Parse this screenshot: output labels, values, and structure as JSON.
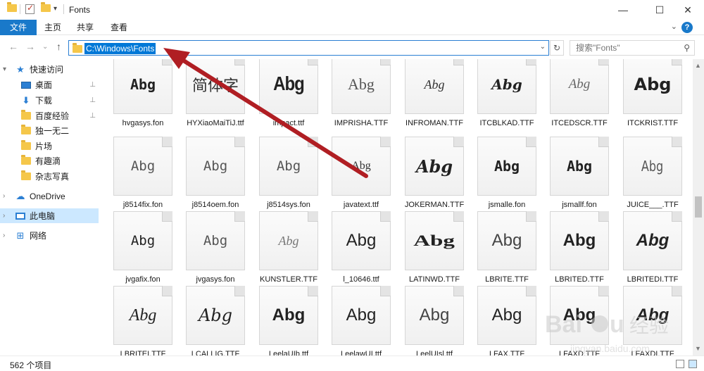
{
  "window": {
    "title": "Fonts",
    "minimize": "—",
    "maximize": "☐",
    "close": "✕"
  },
  "ribbon": {
    "tabs": [
      "文件",
      "主页",
      "共享",
      "查看"
    ],
    "help": "?",
    "collapse": "⌄"
  },
  "nav": {
    "back": "←",
    "forward": "→",
    "recent": "⌄",
    "up": "↑"
  },
  "address": {
    "path": "C:\\Windows\\Fonts",
    "dropdown": "⌄",
    "refresh": "↻"
  },
  "search": {
    "placeholder": "搜索\"Fonts\"",
    "icon": "⚲"
  },
  "sidebar": {
    "items": [
      {
        "label": "快速访问",
        "icon": "star-icon"
      },
      {
        "label": "桌面",
        "icon": "desktop-icon",
        "pinned": true
      },
      {
        "label": "下载",
        "icon": "download-icon",
        "pinned": true
      },
      {
        "label": "百度经验",
        "icon": "folder-icon",
        "pinned": true
      },
      {
        "label": "独一无二",
        "icon": "folder-icon"
      },
      {
        "label": "片场",
        "icon": "folder-icon"
      },
      {
        "label": "有趣滴",
        "icon": "folder-icon"
      },
      {
        "label": "杂志写真",
        "icon": "folder-icon"
      },
      {
        "label": "OneDrive",
        "icon": "cloud-icon"
      },
      {
        "label": "此电脑",
        "icon": "pc-icon",
        "selected": true
      },
      {
        "label": "网络",
        "icon": "network-icon"
      }
    ],
    "pin_glyph": "📌"
  },
  "files": [
    {
      "name": "hvgasys.fon",
      "sample": "Abg",
      "style": "bold-mono"
    },
    {
      "name": "HYXiaoMaiTiJ.ttf",
      "sample": "简体字",
      "style": "cjk"
    },
    {
      "name": "impact.ttf",
      "sample": "Abg",
      "style": "impact"
    },
    {
      "name": "IMPRISHA.TTF",
      "sample": "Abg",
      "style": "serif-light"
    },
    {
      "name": "INFROMAN.TTF",
      "sample": "Abg",
      "style": "script-small"
    },
    {
      "name": "ITCBLKAD.TTF",
      "sample": "Abg",
      "style": "blackletter"
    },
    {
      "name": "ITCEDSCR.TTF",
      "sample": "Abg",
      "style": "script-light"
    },
    {
      "name": "ITCKRIST.TTF",
      "sample": "Abg",
      "style": "kristen"
    },
    {
      "name": "j8514fix.fon",
      "sample": "Abg",
      "style": "mono-gray"
    },
    {
      "name": "j8514oem.fon",
      "sample": "Abg",
      "style": "mono-gray"
    },
    {
      "name": "j8514sys.fon",
      "sample": "Abg",
      "style": "mono-gray"
    },
    {
      "name": "javatext.ttf",
      "sample": "Abg",
      "style": "java"
    },
    {
      "name": "JOKERMAN.TTF",
      "sample": "Abg",
      "style": "jokerman"
    },
    {
      "name": "jsmalle.fon",
      "sample": "Abg",
      "style": "pixel"
    },
    {
      "name": "jsmallf.fon",
      "sample": "Abg",
      "style": "pixel"
    },
    {
      "name": "JUICE___.TTF",
      "sample": "Abg",
      "style": "juice"
    },
    {
      "name": "jvgafix.fon",
      "sample": "Abg",
      "style": "mono-dark"
    },
    {
      "name": "jvgasys.fon",
      "sample": "Abg",
      "style": "mono-gray"
    },
    {
      "name": "KUNSTLER.TTF",
      "sample": "Abg",
      "style": "kunstler"
    },
    {
      "name": "l_10646.ttf",
      "sample": "Abg",
      "style": "sans"
    },
    {
      "name": "LATINWD.TTF",
      "sample": "Abg",
      "style": "latinwide"
    },
    {
      "name": "LBRITE.TTF",
      "sample": "Abg",
      "style": "sans-light"
    },
    {
      "name": "LBRITED.TTF",
      "sample": "Abg",
      "style": "sans-bold"
    },
    {
      "name": "LBRITEDI.TTF",
      "sample": "Abg",
      "style": "sans-bold-italic"
    },
    {
      "name": "LBRITEI.TTF",
      "sample": "Abg",
      "style": "sans-italic"
    },
    {
      "name": "LCALLIG.TTF",
      "sample": "Abg",
      "style": "callig"
    },
    {
      "name": "LeelaUIb.ttf",
      "sample": "Abg",
      "style": "sans-bold"
    },
    {
      "name": "LeelawUI.ttf",
      "sample": "Abg",
      "style": "sans"
    },
    {
      "name": "LeelUIsl.ttf",
      "sample": "Abg",
      "style": "sans-light"
    },
    {
      "name": "LFAX.TTF",
      "sample": "Abg",
      "style": "sans"
    },
    {
      "name": "LFAXD.TTF",
      "sample": "Abg",
      "style": "sans-bold"
    },
    {
      "name": "LFAXDI.TTF",
      "sample": "Abg",
      "style": "sans-bold-italic"
    }
  ],
  "status": {
    "count": "562 个项目"
  },
  "colors": {
    "accent": "#1979ca",
    "selection": "#0078d7",
    "annotation_arrow": "#b01e23"
  }
}
